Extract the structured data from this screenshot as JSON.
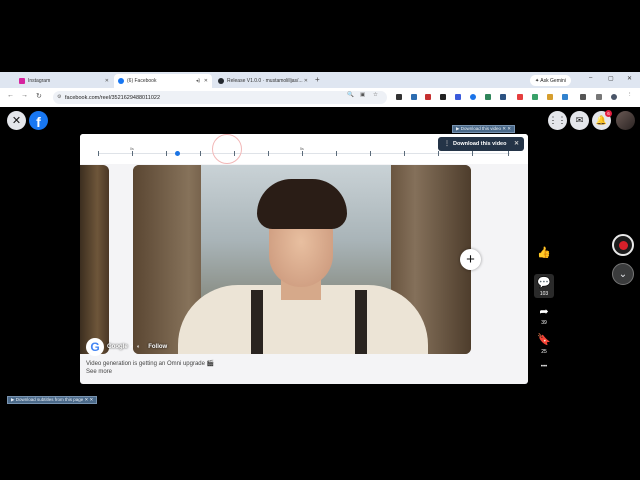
{
  "browser": {
    "tabs": [
      {
        "title": "Instagram",
        "favicon_color": "#d6249f",
        "active": false
      },
      {
        "title": "(6) Facebook",
        "favicon_color": "#1877f2",
        "active": true
      },
      {
        "title": "Release V1.0.0 · mustamolilljas/...",
        "favicon_color": "#24292f",
        "active": false
      }
    ],
    "new_tab": "+",
    "ask_gemini": "✦ Ask Gemini",
    "window_controls": {
      "minimize": "–",
      "maximize": "▢",
      "close": "✕"
    },
    "url": "facebook.com/reel/3521629488011022",
    "nav": {
      "back": "←",
      "forward": "→",
      "reload": "↻"
    }
  },
  "facebook": {
    "logo": "f",
    "close_icon": "✕",
    "menu_icon": "⋮⋮",
    "messenger_icon": "✉",
    "notifications_icon": "🔔",
    "notification_count": "6"
  },
  "video": {
    "scrub_labels": [
      "0s",
      "5s"
    ],
    "download_label": "▶ Download this video",
    "download_label_close": "✕ ✕",
    "tooltip_text": "Download this video",
    "tooltip_dots": "⋮",
    "tooltip_close": "✕",
    "plus_icon": "+",
    "author_initial": "G",
    "author_name": "Google",
    "verified_icon": "✓",
    "globe_icon": "◐",
    "follow_label": "Follow",
    "caption": "Video generation is getting an Omni upgrade 🎬",
    "see_more": "See more"
  },
  "rail": {
    "like_icon": "👍",
    "comment_icon": "💬",
    "comment_count": "103",
    "share_icon": "➦",
    "share_count": "39",
    "save_icon": "🔖",
    "save_count": "25",
    "more_icon": "•••"
  },
  "side_controls": {
    "down_icon": "⌄"
  },
  "subtitle_label": "▶ Download subtitles from this page",
  "subtitle_label_close": "✕ ✕"
}
